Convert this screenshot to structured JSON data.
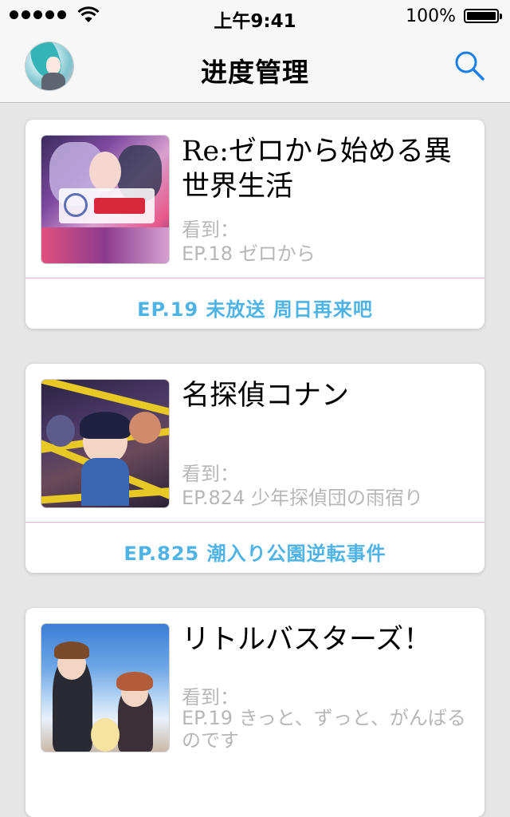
{
  "status_bar": {
    "time": "上午9:41",
    "battery": "100%"
  },
  "nav": {
    "title": "进度管理",
    "avatar_icon": "user-avatar",
    "search_icon": "search-icon"
  },
  "accent_color": "#4fb3e6",
  "cards": [
    {
      "title": "Re:ゼロから始める異世界生活",
      "seen_label": "看到：",
      "seen_episode": "EP.18 ゼロから",
      "next_episode": "EP.19 未放送 周日再来吧"
    },
    {
      "title": "名探偵コナン",
      "seen_label": "看到：",
      "seen_episode": "EP.824 少年探偵団の雨宿り",
      "next_episode": "EP.825 潮入り公園逆転事件"
    },
    {
      "title": "リトルバスターズ！",
      "seen_label": "看到：",
      "seen_episode": "EP.19 きっと、ずっと、がんばるのです",
      "next_episode": ""
    }
  ]
}
